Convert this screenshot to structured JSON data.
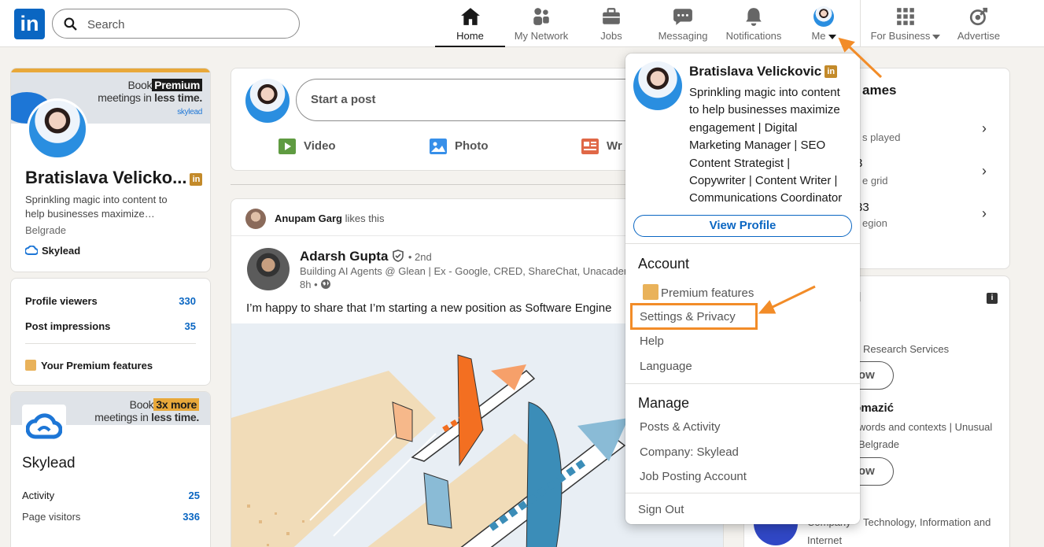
{
  "nav": {
    "logo": "in",
    "search_placeholder": "Search",
    "items": [
      {
        "label": "Home"
      },
      {
        "label": "My Network"
      },
      {
        "label": "Jobs"
      },
      {
        "label": "Messaging"
      },
      {
        "label": "Notifications"
      },
      {
        "label": "Me"
      },
      {
        "label": "For Business"
      },
      {
        "label": "Advertise"
      }
    ]
  },
  "profile_card": {
    "banner_line1_prefix": "Book",
    "banner_line1_tag": "Premium",
    "banner_line2_prefix": "meetings in",
    "banner_line2_bold": "less time.",
    "banner_brand": "skylead",
    "name": "Bratislava Velicko...",
    "badge": "in",
    "headline_line1": "Sprinkling magic into content to",
    "headline_line2": "help businesses maximize…",
    "location": "Belgrade",
    "company": "Skylead"
  },
  "stats_card": {
    "viewers_label": "Profile viewers",
    "viewers_value": "330",
    "impressions_label": "Post impressions",
    "impressions_value": "35",
    "premium_label": "Your Premium features"
  },
  "page_card": {
    "banner_line1_prefix": "Book",
    "banner_line1_tag": "3x more",
    "banner_line2_prefix": "meetings in",
    "banner_line2_bold": "less time.",
    "name": "Skylead",
    "activity_label": "Activity",
    "activity_value": "25",
    "visitors_label": "Page visitors",
    "visitors_value": "336"
  },
  "post_box": {
    "placeholder": "Start a post",
    "video": "Video",
    "photo": "Photo",
    "write": "Wr"
  },
  "feed_post": {
    "liker": "Anupam Garg",
    "likes_this": "likes this",
    "author": "Adarsh Gupta",
    "degree": "• 2nd",
    "author_headline": "Building AI Agents @ Glean | Ex - Google, CRED, ShareChat, Unacaden",
    "time": "8h •",
    "text": "I’m happy to share that I’m starting a new position as Software Engine"
  },
  "right_card": {
    "title": "ames",
    "rows": [
      {
        "sub": "s played"
      },
      {
        "sub": "e grid",
        "prefix": "3"
      },
      {
        "sub": "egion",
        "prefix": "33"
      }
    ]
  },
  "right_card2": {
    "line1": "Research Services",
    "follow": "ow",
    "name2": "lomazić",
    "line2": "words and contexts | Unusual",
    "line3": "Belgrade",
    "follow2": "ow",
    "line4": "Technology, Information and",
    "line5": "Internet",
    "line6": "Company"
  },
  "dropdown": {
    "name": "Bratislava Velickovic",
    "badge": "in",
    "headline": [
      "Sprinkling magic into content",
      "to help businesses maximize",
      "engagement | Digital",
      "Marketing Manager | SEO",
      "Content Strategist |",
      "Copywriter | Content Writer |",
      "Communications Coordinator"
    ],
    "view_profile": "View Profile",
    "account_title": "Account",
    "account_items": [
      "Premium features",
      "Settings & Privacy",
      "Help",
      "Language"
    ],
    "manage_title": "Manage",
    "manage_items": [
      "Posts & Activity",
      "Company: Skylead",
      "Job Posting Account"
    ],
    "sign_out": "Sign Out"
  },
  "colors": {
    "brand": "#0a66c2",
    "highlight": "#f28c28",
    "premium": "#c38a2a"
  }
}
